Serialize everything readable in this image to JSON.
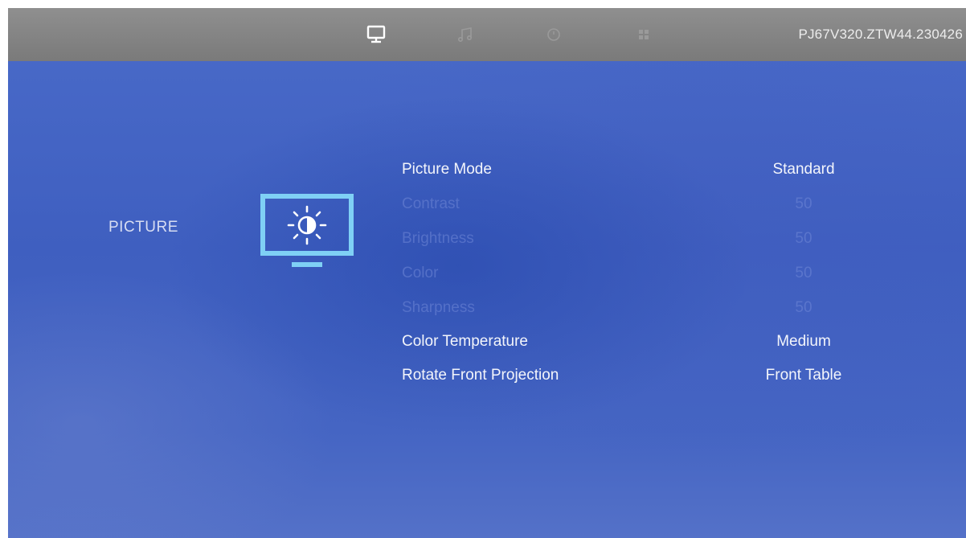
{
  "header": {
    "tabs": [
      {
        "icon": "monitor-icon",
        "selected": true
      },
      {
        "icon": "music-note-icon",
        "selected": false
      },
      {
        "icon": "clock-icon",
        "selected": false
      },
      {
        "icon": "grid-icon",
        "selected": false
      }
    ],
    "firmware_version": "PJ67V320.ZTW44.230426"
  },
  "section": {
    "title": "PICTURE",
    "icon": "picture-settings-icon"
  },
  "menu": {
    "items": [
      {
        "label": "Picture Mode",
        "value": "Standard",
        "enabled": true
      },
      {
        "label": "Contrast",
        "value": "50",
        "enabled": false
      },
      {
        "label": "Brightness",
        "value": "50",
        "enabled": false
      },
      {
        "label": "Color",
        "value": "50",
        "enabled": false
      },
      {
        "label": "Sharpness",
        "value": "50",
        "enabled": false
      },
      {
        "label": "Color Temperature",
        "value": "Medium",
        "enabled": true
      },
      {
        "label": "Rotate Front Projection",
        "value": "Front Table",
        "enabled": true
      }
    ]
  },
  "colors": {
    "background": "#4565c3",
    "topbar": "#858585",
    "accent_icon": "#7fd0f5",
    "text_active": "#f3f5fb",
    "text_disabled": "#6f87d6"
  }
}
